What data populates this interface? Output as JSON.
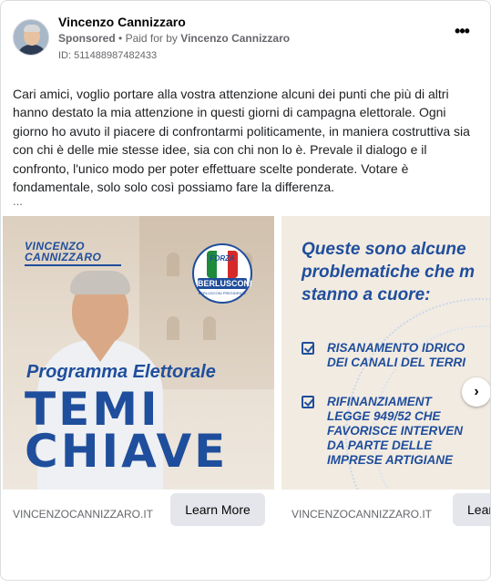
{
  "post": {
    "author": "Vincenzo Cannizzaro",
    "sponsored": "Sponsored",
    "separator": "•",
    "paid_for": "Paid for by",
    "paid_by": "Vincenzo Cannizzaro",
    "ad_id": "ID: 511488987482433",
    "more_icon": "more-horizontal-icon",
    "more_glyph": "•••",
    "body": "Cari amici, voglio portare alla vostra attenzione alcuni dei punti che più di altri hanno destato la mia attenzione in questi giorni di campagna elettorale. Ogni giorno ho avuto il piacere di confrontarmi politicamente, in maniera costruttiva sia con chi è delle mie stesse idee, sia con chi non lo è. Prevale il dialogo e il confronto, l'unico modo per poter effettuare scelte ponderate. Votare è fondamentale, solo solo così possiamo fare la differenza.",
    "see_more": "..."
  },
  "carousel": {
    "slides": [
      {
        "logo_line1": "VINCENZO",
        "logo_line2": "CANNIZZARO",
        "party_top": "FORZA",
        "party_mid": "ITALIA",
        "party_name": "BERLUSCONI",
        "party_small": "BERLUSCONI PRESIDENTE",
        "subtitle": "Programma Elettorale",
        "headline1": "TEMI",
        "headline2": "CHIAVE",
        "domain": "VINCENZOCANNIZZARO.IT",
        "cta": "Learn More"
      },
      {
        "title_line1": "Queste sono alcune",
        "title_line2": "problematiche che m",
        "title_line3": "stanno a cuore:",
        "item1_line1": "RISANAMENTO IDRICO",
        "item1_line2": "DEI CANALI DEL TERRI",
        "item2_line1": "RIFINANZIAMENT",
        "item2_line2": "LEGGE 949/52 CHE",
        "item2_line3": "FAVORISCE INTERVEN",
        "item2_line4": "DA PARTE DELLE",
        "item2_line5": "IMPRESE ARTIGIANE",
        "domain": "VINCENZOCANNIZZARO.IT",
        "cta": "Learn More"
      }
    ],
    "next_icon": "chevron-right-icon",
    "next_glyph": "›"
  },
  "colors": {
    "brand_blue": "#1f4e9c",
    "button_bg": "#e4e6eb",
    "secondary_text": "#65676b"
  }
}
